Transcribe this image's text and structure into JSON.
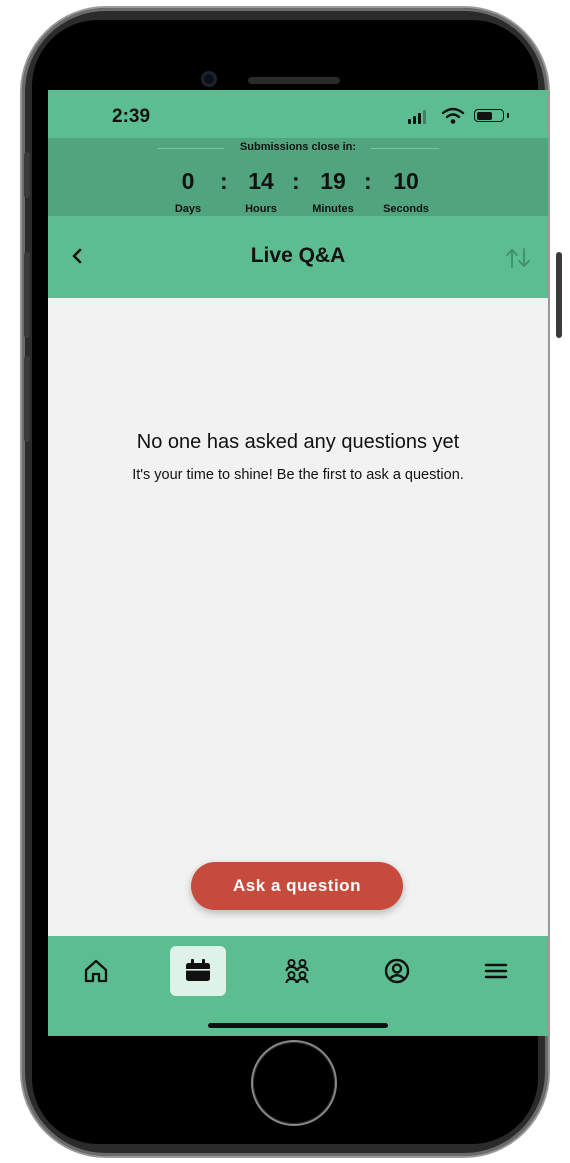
{
  "status_bar": {
    "time": "2:39"
  },
  "countdown": {
    "title": "Submissions close in:",
    "units": [
      {
        "value": "0",
        "label": "Days"
      },
      {
        "value": "14",
        "label": "Hours"
      },
      {
        "value": "19",
        "label": "Minutes"
      },
      {
        "value": "10",
        "label": "Seconds"
      }
    ],
    "separator": ":"
  },
  "header": {
    "title": "Live Q&A",
    "back_icon": "chevron-left-icon",
    "sort_icon": "sort-arrows-icon"
  },
  "empty_state": {
    "title": "No one has asked any questions yet",
    "subtitle": "It's your time to shine! Be the first to ask a question."
  },
  "ask_button": {
    "label": "Ask a question"
  },
  "tabbar": {
    "items": [
      {
        "icon": "home-icon",
        "active": false
      },
      {
        "icon": "calendar-icon",
        "active": true
      },
      {
        "icon": "people-icon",
        "active": false
      },
      {
        "icon": "profile-icon",
        "active": false
      },
      {
        "icon": "menu-icon",
        "active": false
      }
    ]
  },
  "colors": {
    "primary_green": "#5bbd90",
    "countdown_green": "#50a57e",
    "button_red": "#c64b3c",
    "background": "#f2f2f2",
    "active_tab": "#dff2e8"
  }
}
